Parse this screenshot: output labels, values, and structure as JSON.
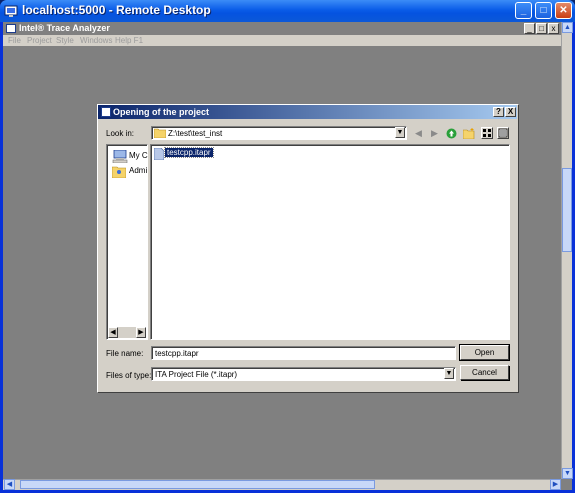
{
  "window": {
    "title": "localhost:5000 - Remote Desktop",
    "min": "_",
    "max": "□",
    "close": "✕"
  },
  "app": {
    "title": "Intel® Trace Analyzer",
    "min": "_",
    "max": "□",
    "close": "x"
  },
  "menu": [
    "File",
    "Project",
    "Style",
    "Windows",
    "Help F1"
  ],
  "dialog": {
    "title": "Opening of the project",
    "help": "?",
    "close": "X",
    "look_in_label": "Look in:",
    "look_in_value": "Z:\\test\\test_inst",
    "places": [
      "My C",
      "Admi"
    ],
    "files": [
      "testcpp.itapr"
    ],
    "file_name_label": "File name:",
    "file_name_value": "testcpp.itapr",
    "file_type_label": "Files of type:",
    "file_type_value": "ITA Project File (*.itapr)",
    "open_label": "Open",
    "cancel_label": "Cancel"
  },
  "colors": {
    "xp_title": "#0a5ce8",
    "workspace": "#808080",
    "dialog_title": "#0a246a",
    "face": "#d4d0c8"
  },
  "icons": [
    "remote-desktop-icon",
    "app-icon",
    "folder-icon",
    "back-icon",
    "forward-icon",
    "up-folder-icon",
    "new-folder-icon",
    "list-view-icon",
    "details-view-icon",
    "computer-icon",
    "user-folder-icon",
    "file-icon"
  ]
}
